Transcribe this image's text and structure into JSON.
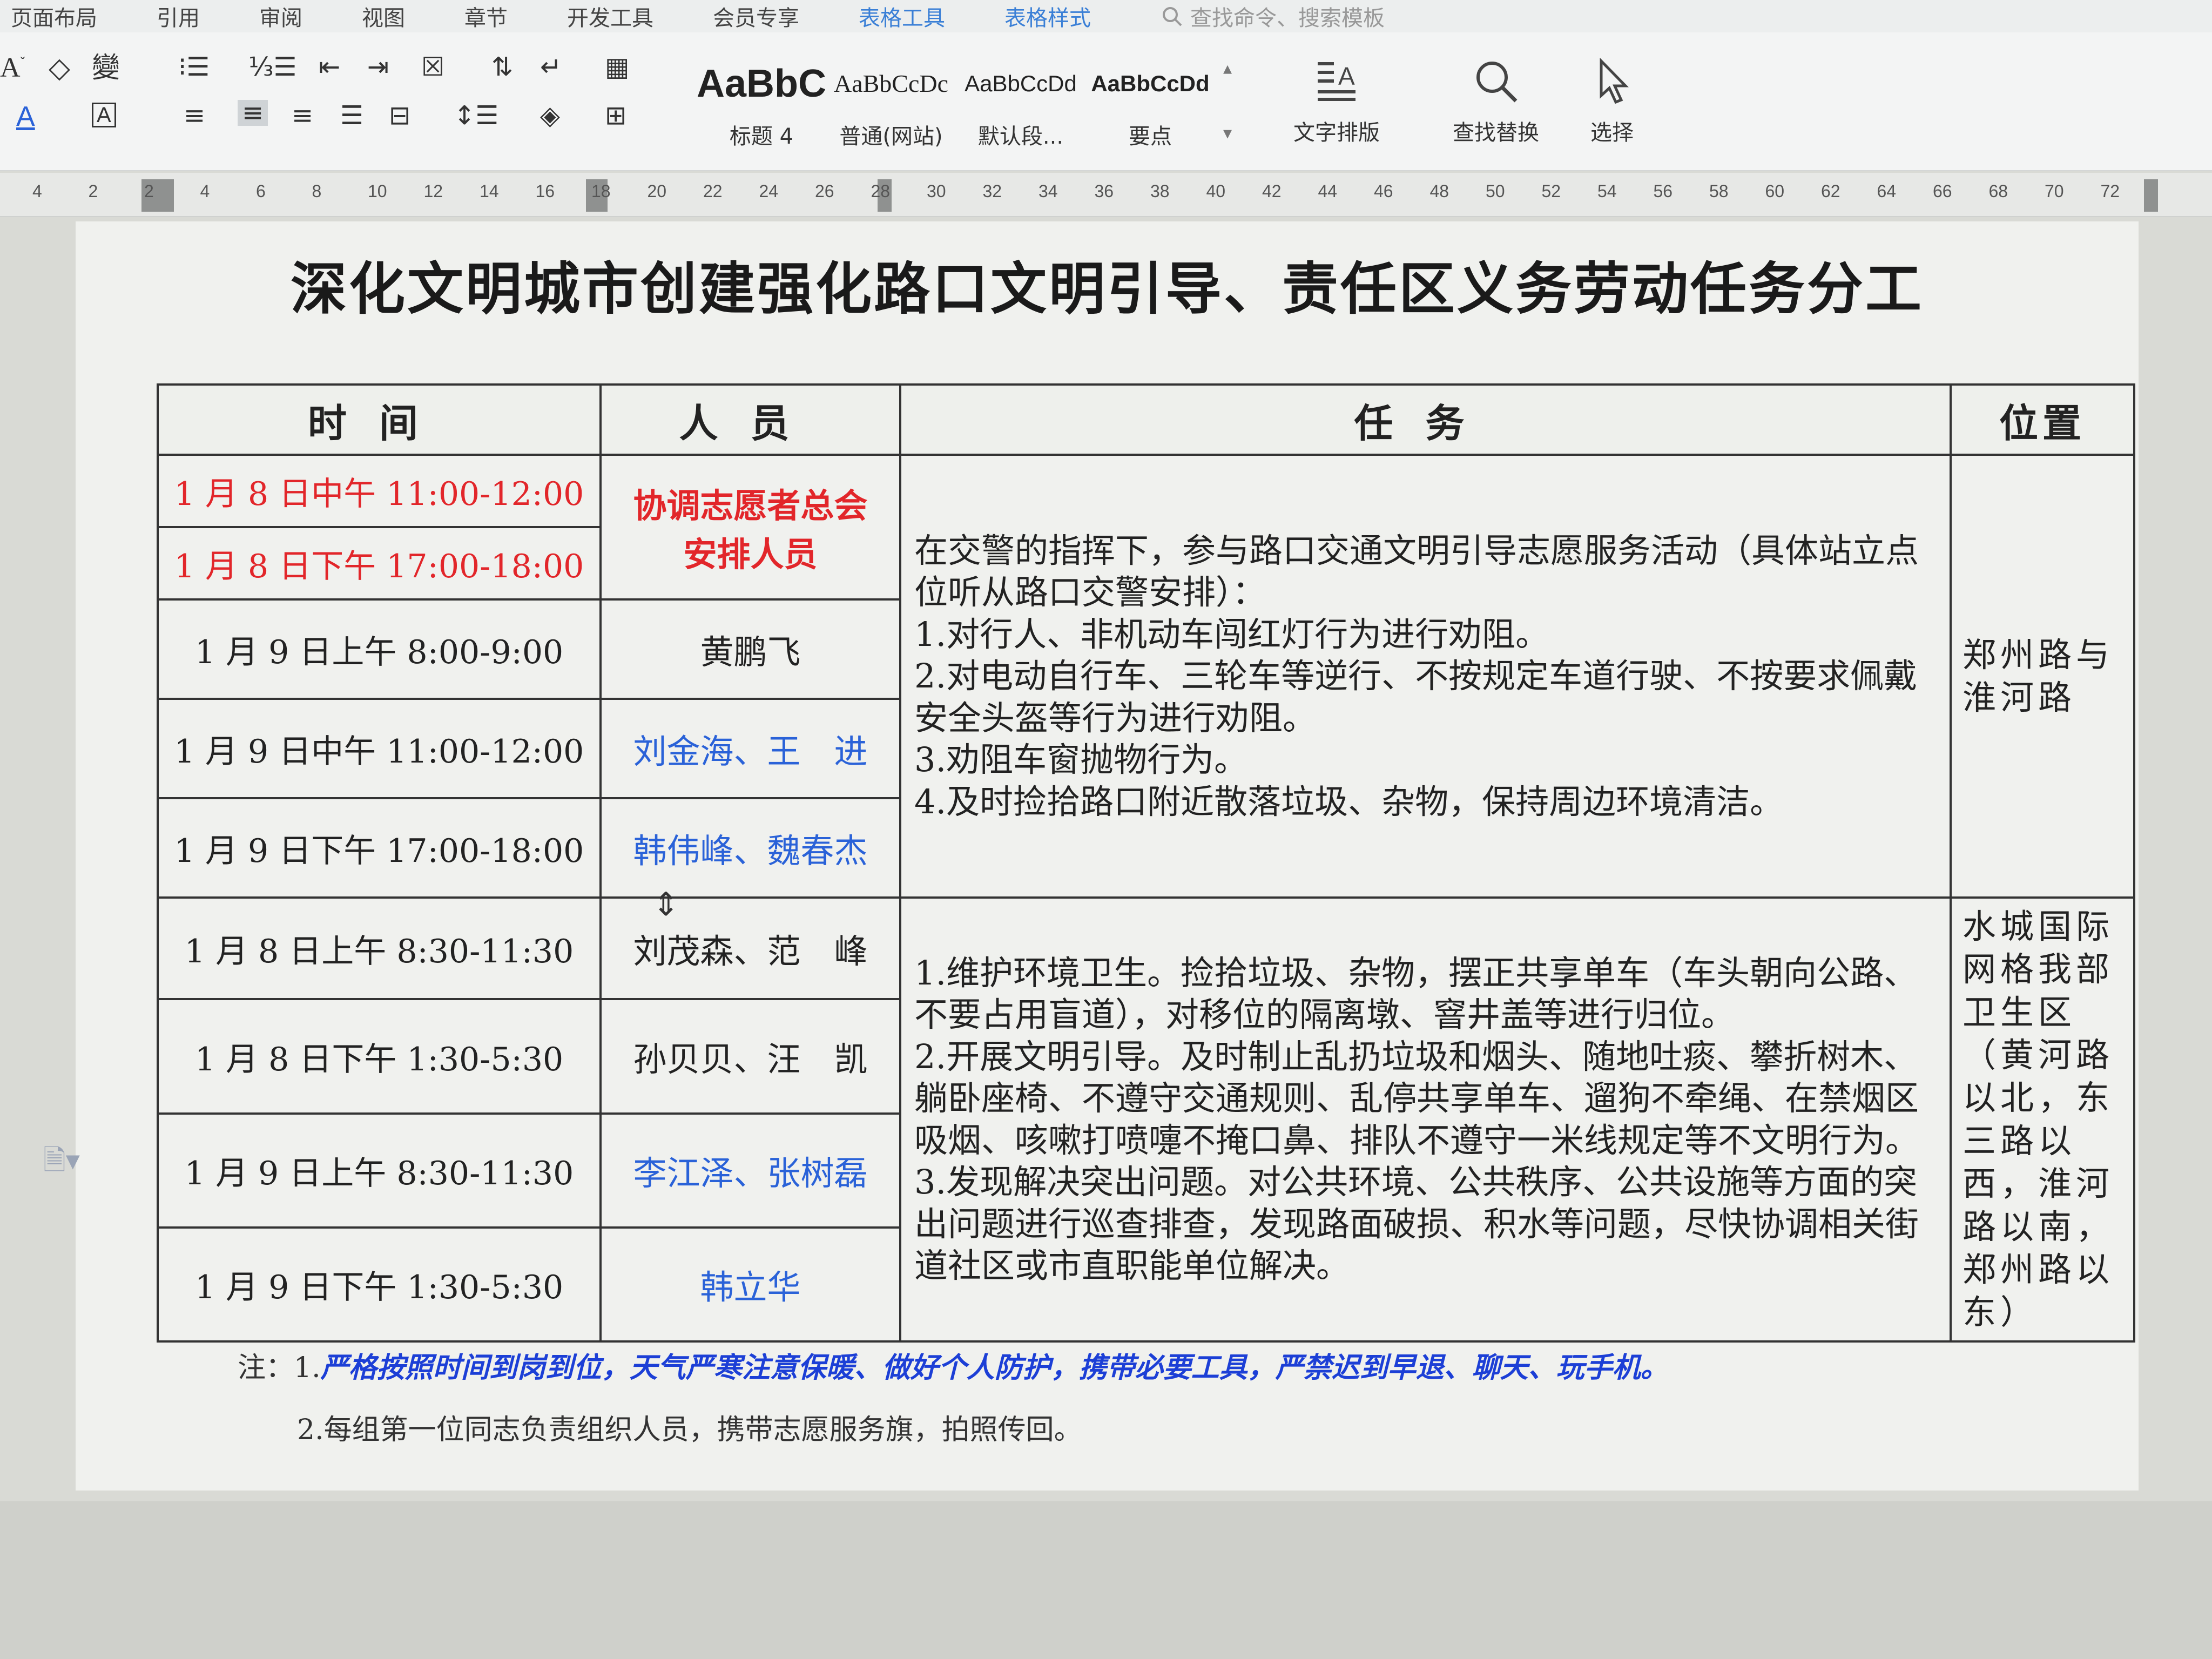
{
  "menu": {
    "items": [
      "页面布局",
      "引用",
      "审阅",
      "视图",
      "章节",
      "开发工具",
      "会员专享",
      "表格工具",
      "表格样式"
    ],
    "active_items": [
      "表格工具",
      "表格样式"
    ],
    "search_placeholder": "查找命令、搜索模板"
  },
  "ribbon": {
    "styles": [
      {
        "sample": "AaBbC",
        "label": "标题 4"
      },
      {
        "sample": "AaBbCcDc",
        "label": "普通(网站)"
      },
      {
        "sample": "AaBbCcDd",
        "label": "默认段..."
      },
      {
        "sample": "AaBbCcDd",
        "label": "要点"
      }
    ],
    "text_layout_label": "文字排版",
    "find_replace_label": "查找替换",
    "select_label": "选择",
    "phonetic_glyph": "變"
  },
  "ruler": {
    "ticks": [
      "4",
      "2",
      "2",
      "4",
      "6",
      "8",
      "10",
      "12",
      "14",
      "16",
      "18",
      "20",
      "22",
      "24",
      "26",
      "28",
      "30",
      "32",
      "34",
      "36",
      "38",
      "40",
      "42",
      "44",
      "46",
      "48",
      "50",
      "52",
      "54",
      "56",
      "58",
      "60",
      "62",
      "64",
      "66",
      "68",
      "70",
      "72"
    ]
  },
  "document": {
    "title": "深化文明城市创建强化路口文明引导、责任区义务劳动任务分工",
    "table": {
      "headers": {
        "time": "时间",
        "people": "人员",
        "task": "任务",
        "location": "位置"
      },
      "group1": {
        "rows": [
          {
            "time": "1 月 8 日中午 11:00-12:00"
          },
          {
            "time": "1 月 8 日下午 17:00-18:00"
          },
          {
            "time": "1 月 9 日上午 8:00-9:00",
            "people": "黄鹏飞"
          },
          {
            "time": "1 月 9 日中午 11:00-12:00",
            "people": "刘金海、王　进"
          },
          {
            "time": "1 月 9 日下午 17:00-18:00",
            "people": "韩伟峰、魏春杰"
          }
        ],
        "coordinator": {
          "line1": "协调志愿者总会",
          "line2": "安排人员"
        },
        "task_lines": [
          "在交警的指挥下，参与路口交通文明引导志愿服务活动（具体站立点位听从路口交警安排）：",
          "1.对行人、非机动车闯红灯行为进行劝阻。",
          "2.对电动自行车、三轮车等逆行、不按规定车道行驶、不按要求佩戴安全头盔等行为进行劝阻。",
          "3.劝阻车窗抛物行为。",
          "4.及时捡拾路口附近散落垃圾、杂物，保持周边环境清洁。"
        ],
        "location": "郑州路与淮河路"
      },
      "group2": {
        "rows": [
          {
            "time": "1 月 8 日上午 8:30-11:30",
            "people": "刘茂森、范　峰"
          },
          {
            "time": "1 月 8 日下午 1:30-5:30",
            "people": "孙贝贝、汪　凯"
          },
          {
            "time": "1 月 9 日上午 8:30-11:30",
            "people": "李江泽、张树磊"
          },
          {
            "time": "1 月 9 日下午 1:30-5:30",
            "people": "韩立华"
          }
        ],
        "task_lines": [
          "1.维护环境卫生。捡拾垃圾、杂物，摆正共享单车（车头朝向公路、不要占用盲道），对移位的隔离墩、窨井盖等进行归位。",
          "2.开展文明引导。及时制止乱扔垃圾和烟头、随地吐痰、攀折树木、躺卧座椅、不遵守交通规则、乱停共享单车、遛狗不牵绳、在禁烟区吸烟、咳嗽打喷嚏不掩口鼻、排队不遵守一米线规定等不文明行为。",
          "3.发现解决突出问题。对公共环境、公共秩序、公共设施等方面的突出问题进行巡查排查，发现路面破损、积水等问题，尽快协调相关街道社区或市直职能单位解决。"
        ],
        "location": "水城国际网格我部卫生区（黄河路以北，东三路以西，淮河路以南，郑州路以东）"
      }
    },
    "notes": {
      "prefix": "注：1.",
      "note1": "严格按照时间到岗到位，天气严寒注意保暖、做好个人防护，携带必要工具，严禁迟到早退、聊天、玩手机。",
      "note2": "2.每组第一位同志负责组织人员，携带志愿服务旗，拍照传回。"
    }
  },
  "colors": {
    "red_text": "#e2262a",
    "blue_text": "#2a62d8",
    "note_blue": "#1c3fd6"
  }
}
